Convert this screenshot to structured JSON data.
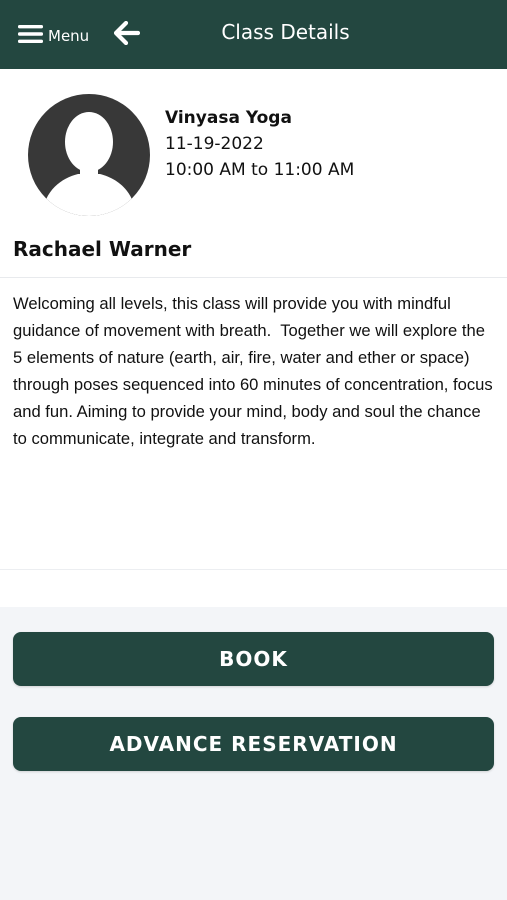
{
  "header": {
    "menu_label": "Menu",
    "title": "Class Details",
    "menu_icon": "hamburger-icon",
    "back_icon": "arrow-left-icon",
    "background_color": "#234740"
  },
  "class": {
    "name": "Vinyasa Yoga",
    "date": "11-19-2022",
    "time": "10:00 AM to 11:00 AM",
    "instructor": "Rachael Warner",
    "avatar_icon": "person-silhouette-icon",
    "description": "Welcoming all levels, this class will provide you with mindful guidance of movement with breath.  Together we will explore the 5 elements of nature (earth, air, fire, water and ether or space) through poses sequenced into 60 minutes of concentration, focus and fun. Aiming to provide your mind, body and soul the chance to communicate, integrate and transform."
  },
  "actions": {
    "book_label": "BOOK",
    "advance_label": "ADVANCE RESERVATION",
    "button_color": "#234740"
  }
}
